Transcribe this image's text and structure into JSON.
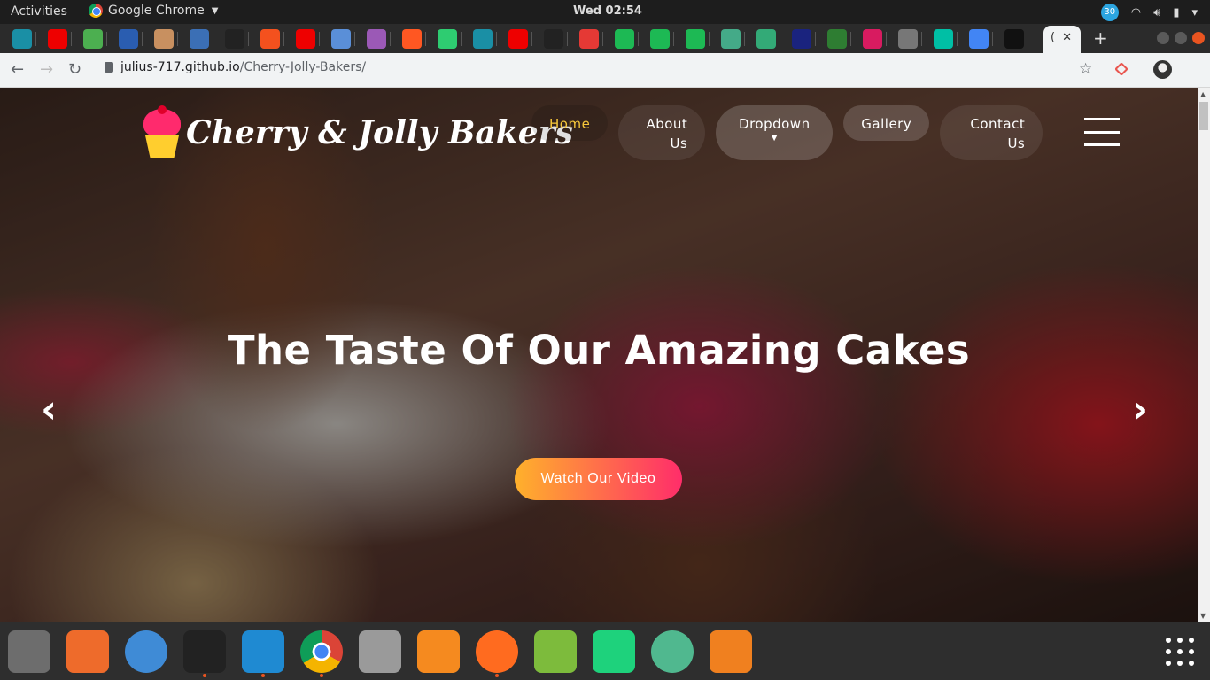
{
  "topbar": {
    "activities": "Activities",
    "app_name": "Google Chrome",
    "clock": "Wed 02:54",
    "telegram_badge": "30"
  },
  "tabs": {
    "active_label": "(",
    "close": "✕",
    "new_tab": "+"
  },
  "omnibar": {
    "host": "julius-717.github.io",
    "path": "/Cherry-Jolly-Bakers/"
  },
  "site": {
    "logo": "Cherry & Jolly Bakers",
    "nav": {
      "home": "Home",
      "about": "About Us",
      "dropdown": "Dropdown",
      "gallery": "Gallery",
      "contact": "Contact Us"
    },
    "hero_title": "The Taste Of Our Amazing Cakes",
    "cta": "Watch Our Video",
    "accent_color": "#f7c83a"
  },
  "dock": {
    "apps": [
      "files-icon",
      "software-icon",
      "help-icon",
      "terminal-icon",
      "vscode-icon",
      "chrome-icon",
      "settings-icon",
      "vlc-icon",
      "firefox-icon",
      "android-studio-icon",
      "pycharm-icon",
      "atom-icon",
      "blender-icon"
    ],
    "colors": [
      "#6d6d6d",
      "#ee6b2b",
      "#3f8bd6",
      "#222",
      "#1f8ad2",
      "#dd4b39",
      "#9a9a9a",
      "#f58a1f",
      "#ff6b1f",
      "#7dbb3c",
      "#1ed27c",
      "#50b88f",
      "#f0801f"
    ]
  }
}
